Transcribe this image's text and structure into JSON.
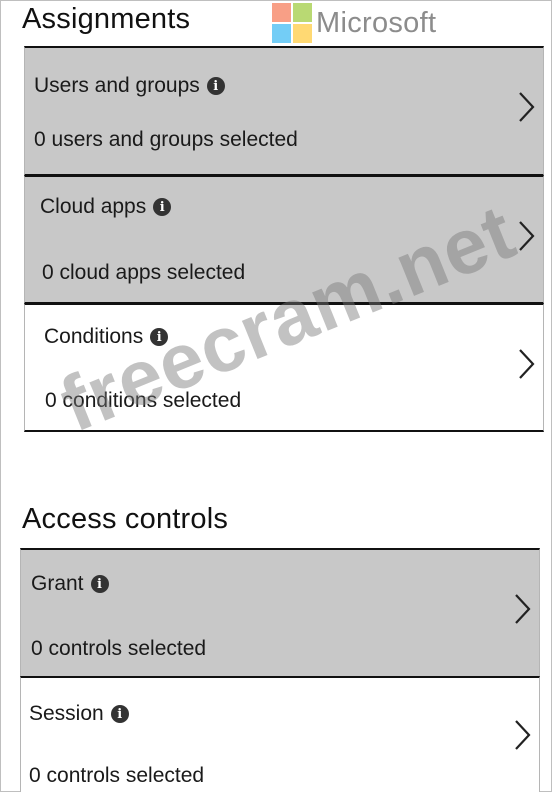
{
  "assignments": {
    "title": "Assignments",
    "items": [
      {
        "label": "Users and groups",
        "summary": "0 users and groups selected"
      },
      {
        "label": "Cloud apps",
        "summary": "0 cloud apps selected"
      },
      {
        "label": "Conditions",
        "summary": "0 conditions selected"
      }
    ]
  },
  "access_controls": {
    "title": "Access controls",
    "items": [
      {
        "label": "Grant",
        "summary": "0 controls selected"
      },
      {
        "label": "Session",
        "summary": "0 controls selected"
      }
    ]
  },
  "branding": {
    "logo_text": "Microsoft",
    "logo_colors": [
      "#f25022",
      "#7fba00",
      "#00a4ef",
      "#ffb900"
    ]
  },
  "watermark": {
    "text": "freecram.net"
  },
  "icons": {
    "info": "info-icon",
    "chevron": "chevron-right-icon"
  }
}
